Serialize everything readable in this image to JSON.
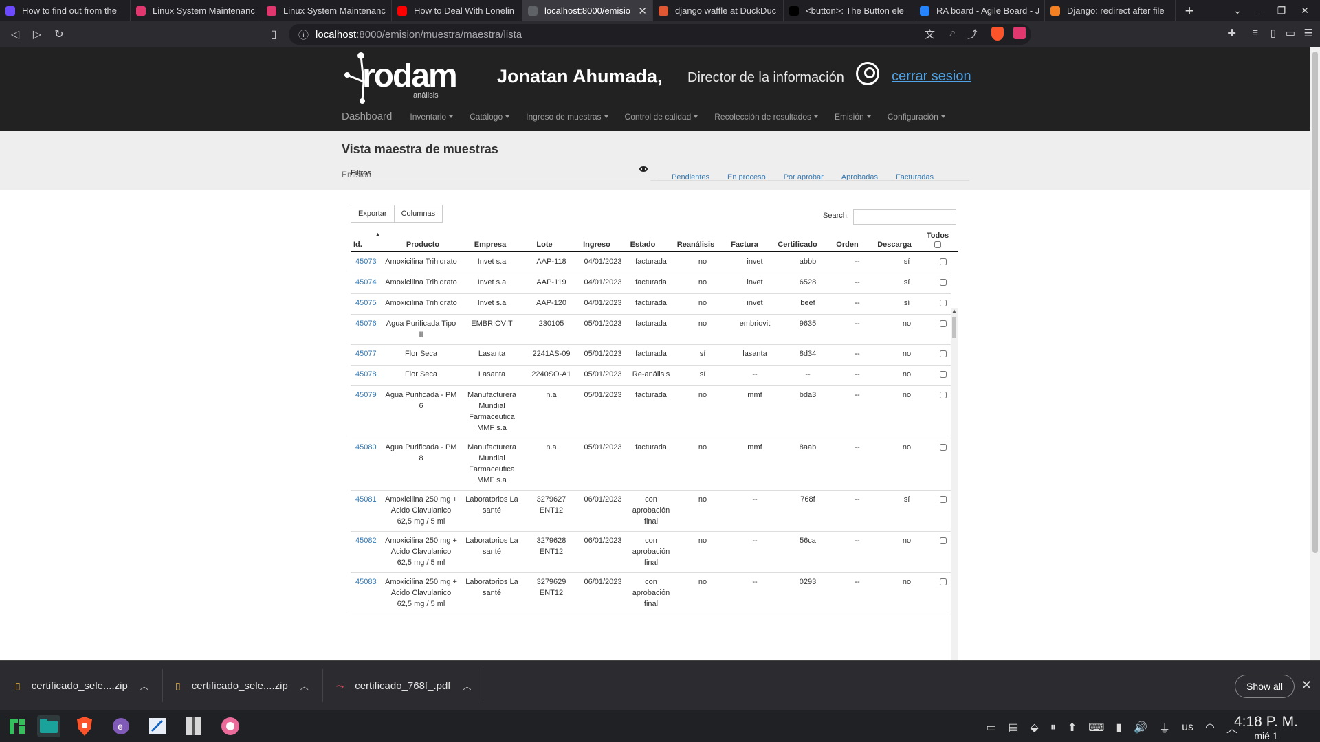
{
  "browser": {
    "tabs": [
      {
        "title": "How to find out from the",
        "favicon_color": "#6d4aff"
      },
      {
        "title": "Linux System Maintenanc",
        "favicon_color": "#e0376f"
      },
      {
        "title": "Linux System Maintenanc",
        "favicon_color": "#e0376f"
      },
      {
        "title": "How to Deal With Lonelin",
        "favicon_color": "#ff0000"
      },
      {
        "title": "localhost:8000/emisio",
        "favicon_color": "#5f6368",
        "active": true
      },
      {
        "title": "django waffle at DuckDuc",
        "favicon_color": "#de5833"
      },
      {
        "title": "<button>: The Button ele",
        "favicon_color": "#000000"
      },
      {
        "title": "RA board - Agile Board - Ji",
        "favicon_color": "#2684ff"
      },
      {
        "title": "Django: redirect after file",
        "favicon_color": "#f48024"
      }
    ],
    "url_host": "localhost",
    "url_path": ":8000/emision/muestra/maestra/lista"
  },
  "header": {
    "logo_text": "rodam",
    "logo_sub": "análisis",
    "user_name": "Jonatan Ahumada,",
    "user_role": "Director de la información",
    "logout": "cerrar sesion"
  },
  "menu": {
    "dashboard": "Dashboard",
    "items": [
      "Inventario",
      "Catálogo",
      "Ingreso de muestras",
      "Control de calidad",
      "Recolección de resultados",
      "Emisión",
      "Configuración"
    ]
  },
  "page": {
    "title": "Vista maestra de muestras",
    "subtitle": "Emisión"
  },
  "filters": {
    "label": "Filtros",
    "tabs": [
      "Pendientes",
      "En proceso",
      "Por aprobar",
      "Aprobadas",
      "Facturadas"
    ]
  },
  "toolbar": {
    "export": "Exportar",
    "columns": "Columnas",
    "search_label": "Search:"
  },
  "table": {
    "columns": [
      "Id.",
      "Producto",
      "Empresa",
      "Lote",
      "Ingreso",
      "Estado",
      "Reanálisis",
      "Factura",
      "Certificado",
      "Orden",
      "Descarga",
      "Todos"
    ],
    "rows": [
      [
        "45073",
        "Amoxicilina Trihidrato",
        "Invet s.a",
        "AAP-118",
        "04/01/2023",
        "facturada",
        "no",
        "invet",
        "abbb",
        "--",
        "sí"
      ],
      [
        "45074",
        "Amoxicilina Trihidrato",
        "Invet s.a",
        "AAP-119",
        "04/01/2023",
        "facturada",
        "no",
        "invet",
        "6528",
        "--",
        "sí"
      ],
      [
        "45075",
        "Amoxicilina Trihidrato",
        "Invet s.a",
        "AAP-120",
        "04/01/2023",
        "facturada",
        "no",
        "invet",
        "beef",
        "--",
        "sí"
      ],
      [
        "45076",
        "Agua Purificada Tipo II",
        "EMBRIOVIT",
        "230105",
        "05/01/2023",
        "facturada",
        "no",
        "embriovit",
        "9635",
        "--",
        "no"
      ],
      [
        "45077",
        "Flor Seca",
        "Lasanta",
        "2241AS-09",
        "05/01/2023",
        "facturada",
        "sí",
        "lasanta",
        "8d34",
        "--",
        "no"
      ],
      [
        "45078",
        "Flor Seca",
        "Lasanta",
        "2240SO-A1",
        "05/01/2023",
        "Re-análisis",
        "sí",
        "--",
        "--",
        "--",
        "no"
      ],
      [
        "45079",
        "Agua Purificada - PM 6",
        "Manufacturera Mundial Farmaceutica MMF s.a",
        "n.a",
        "05/01/2023",
        "facturada",
        "no",
        "mmf",
        "bda3",
        "--",
        "no"
      ],
      [
        "45080",
        "Agua Purificada - PM 8",
        "Manufacturera Mundial Farmaceutica MMF s.a",
        "n.a",
        "05/01/2023",
        "facturada",
        "no",
        "mmf",
        "8aab",
        "--",
        "no"
      ],
      [
        "45081",
        "Amoxicilina 250 mg + Acido Clavulanico 62,5 mg / 5 ml",
        "Laboratorios La santé",
        "3279627 ENT12",
        "06/01/2023",
        "con aprobación final",
        "no",
        "--",
        "768f",
        "--",
        "sí"
      ],
      [
        "45082",
        "Amoxicilina 250 mg + Acido Clavulanico 62,5 mg / 5 ml",
        "Laboratorios La santé",
        "3279628 ENT12",
        "06/01/2023",
        "con aprobación final",
        "no",
        "--",
        "56ca",
        "--",
        "no"
      ],
      [
        "45083",
        "Amoxicilina 250 mg + Acido Clavulanico 62,5 mg / 5 ml",
        "Laboratorios La santé",
        "3279629 ENT12",
        "06/01/2023",
        "con aprobación final",
        "no",
        "--",
        "0293",
        "--",
        "no"
      ]
    ]
  },
  "downloads": {
    "items": [
      "certificado_sele....zip",
      "certificado_sele....zip",
      "certificado_768f_.pdf"
    ],
    "show_all": "Show all"
  },
  "taskbar": {
    "keyboard": "us",
    "time": "4:18 P. M.",
    "date": "mié 1"
  }
}
